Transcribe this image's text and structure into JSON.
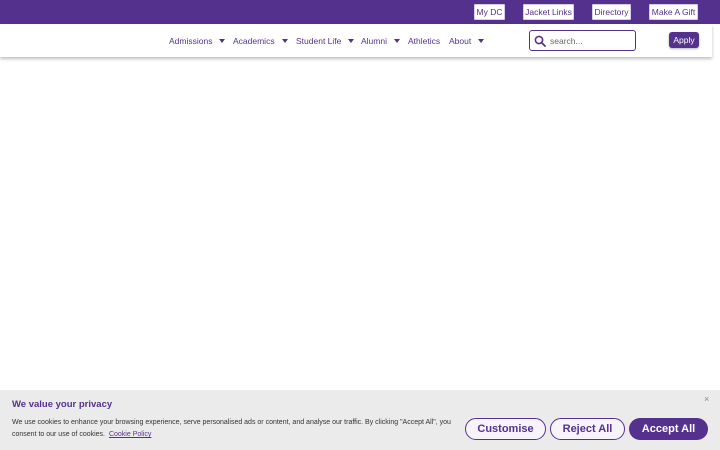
{
  "colors": {
    "brand": "#55318e",
    "banner_bg": "#ebebeb"
  },
  "utility_links": [
    "My DC",
    "Jacket Links",
    "Directory",
    "Make A Gift"
  ],
  "nav": {
    "items": [
      {
        "label": "Admissions",
        "dropdown": true
      },
      {
        "label": "Academics",
        "dropdown": true
      },
      {
        "label": "Student Life",
        "dropdown": true
      },
      {
        "label": "Alumni",
        "dropdown": true
      },
      {
        "label": "Athletics",
        "dropdown": false
      },
      {
        "label": "About",
        "dropdown": true
      }
    ],
    "search_placeholder": "search...",
    "apply_label": "Apply"
  },
  "cookie": {
    "title": "We value your privacy",
    "text": "We use cookies to enhance your browsing experience, serve personalised ads or content, and analyse our traffic. By clicking \"Accept All\", you consent to our use of cookies.",
    "link": "Cookie Policy",
    "close": "×",
    "buttons": {
      "customise": "Customise",
      "reject": "Reject All",
      "accept": "Accept All"
    }
  }
}
